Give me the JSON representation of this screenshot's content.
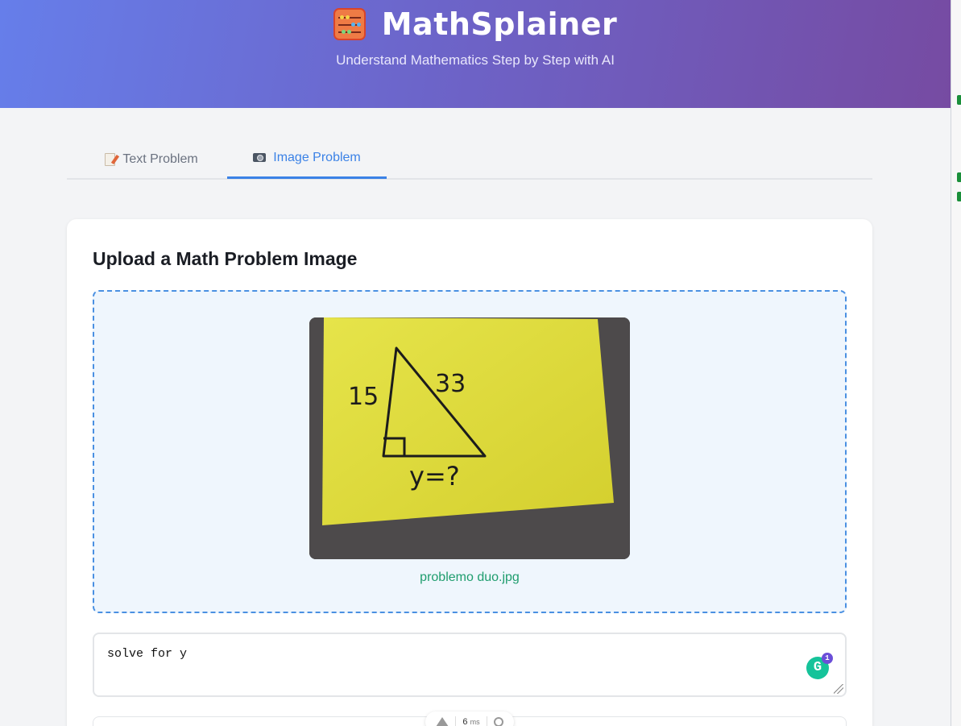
{
  "header": {
    "app_title": "MathSplainer",
    "subtitle": "Understand Mathematics Step by Step with AI",
    "logo_icon": "abacus-icon"
  },
  "tabs": [
    {
      "label": "Text Problem",
      "icon": "memo-icon",
      "active": false
    },
    {
      "label": "Image Problem",
      "icon": "camera-icon",
      "active": true
    }
  ],
  "upload": {
    "title": "Upload a Math Problem Image",
    "file_name": "problemo duo.jpg",
    "image_content": {
      "side_left": "15",
      "hypotenuse": "33",
      "bottom": "y=?"
    }
  },
  "prompt": {
    "value": "solve for y",
    "grammarly_badge": "1",
    "grammarly_letter": "G"
  },
  "devbar": {
    "time_value": "6",
    "time_unit": "ms"
  },
  "colors": {
    "header_start": "#667eea",
    "header_end": "#764ba2",
    "accent": "#3b82e6",
    "file_name": "#1f9d6e"
  }
}
